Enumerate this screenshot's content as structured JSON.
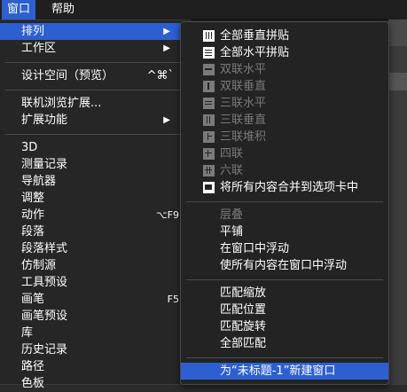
{
  "menubar": {
    "window": "窗口",
    "help": "帮助"
  },
  "main_menu": {
    "arrange": "排列",
    "workspace": "工作区",
    "design_space": "设计空间（预览）",
    "design_space_shortcut": "^⌘`",
    "browse_extensions": "联机浏览扩展...",
    "extensions": "扩展功能",
    "items": [
      {
        "label": "3D",
        "shortcut": ""
      },
      {
        "label": "测量记录",
        "shortcut": ""
      },
      {
        "label": "导航器",
        "shortcut": ""
      },
      {
        "label": "调整",
        "shortcut": ""
      },
      {
        "label": "动作",
        "shortcut": "⌥F9"
      },
      {
        "label": "段落",
        "shortcut": ""
      },
      {
        "label": "段落样式",
        "shortcut": ""
      },
      {
        "label": "仿制源",
        "shortcut": ""
      },
      {
        "label": "工具预设",
        "shortcut": ""
      },
      {
        "label": "画笔",
        "shortcut": "F5"
      },
      {
        "label": "画笔预设",
        "shortcut": ""
      },
      {
        "label": "库",
        "shortcut": ""
      },
      {
        "label": "历史记录",
        "shortcut": ""
      },
      {
        "label": "路径",
        "shortcut": ""
      },
      {
        "label": "色板",
        "shortcut": ""
      }
    ]
  },
  "arrange_submenu": {
    "layouts": [
      {
        "label": "全部垂直拼贴",
        "icon": "tile-vertical-icon",
        "enabled": true
      },
      {
        "label": "全部水平拼贴",
        "icon": "tile-horizontal-icon",
        "enabled": true
      },
      {
        "label": "双联水平",
        "icon": "two-up-horizontal-icon",
        "enabled": false
      },
      {
        "label": "双联垂直",
        "icon": "two-up-vertical-icon",
        "enabled": false
      },
      {
        "label": "三联水平",
        "icon": "three-up-horizontal-icon",
        "enabled": false
      },
      {
        "label": "三联垂直",
        "icon": "three-up-vertical-icon",
        "enabled": false
      },
      {
        "label": "三联堆积",
        "icon": "three-up-stacked-icon",
        "enabled": false
      },
      {
        "label": "四联",
        "icon": "four-up-icon",
        "enabled": false
      },
      {
        "label": "六联",
        "icon": "six-up-icon",
        "enabled": false
      },
      {
        "label": "将所有内容合并到选项卡中",
        "icon": "consolidate-tabs-icon",
        "enabled": true
      }
    ],
    "cascade": "层叠",
    "tile": "平铺",
    "float_in_window": "在窗口中浮动",
    "float_all_in_windows": "使所有内容在窗口中浮动",
    "match_zoom": "匹配缩放",
    "match_location": "匹配位置",
    "match_rotation": "匹配旋转",
    "match_all": "全部匹配",
    "new_window": "为“未标题-1”新建窗口"
  },
  "colors": {
    "highlight": "#2d5fd1",
    "disabled_text": "#7a7a7a",
    "menu_bg": "#262626"
  }
}
